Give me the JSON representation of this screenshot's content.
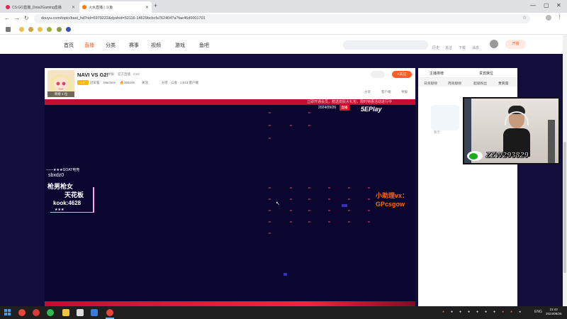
{
  "browser": {
    "tabs": [
      {
        "label": "CS:GO直播_Dota2Gaming直播"
      },
      {
        "label": "火水直播 | 斗鱼"
      }
    ],
    "new_tab": "+",
    "url": "douyu.com/topic/bast_hd?rid=6979222&dyshid=52116-14629bcbcfa762404?a?fae46d0001701",
    "controls": {
      "minimize": "—",
      "maximize": "▢",
      "close": "✕"
    }
  },
  "site_nav": {
    "items": [
      "首页",
      "直播",
      "分类",
      "赛事",
      "视频",
      "游戏",
      "鱼吧"
    ],
    "active_index": 1,
    "header_icons": [
      "历史",
      "关注",
      "下载",
      "消息"
    ],
    "live_button": "开播"
  },
  "room": {
    "title": "NAVI VS G2!",
    "title_suffix": "举报",
    "category": "官方直播 · CS2",
    "level": "LV",
    "anchor_name": "冠军猫",
    "tag": "Machine",
    "heat": "359246",
    "fans": "关注",
    "rank_badge": "周榜 1 位",
    "meta_more": "分享 · 公会 · 1,513 客户端",
    "follow": "+关注",
    "actions": [
      "分享",
      "客户端",
      "举报"
    ]
  },
  "video": {
    "ticker": "立即开通会员，赠送皮肤大礼包，限时特惠活动进行中",
    "date": "2024/09/26",
    "date_badge": "直播",
    "logo": "5EPlay",
    "overlay_left": {
      "line1": "——★★★GOAT电竞",
      "line2": "sbxdz0",
      "line3": "枪男枪女",
      "line4": "天花板",
      "line5": "kook:4628",
      "line6": "★★★"
    },
    "assistant_line1": "小助理vx：",
    "assistant_line2": "GPcsgow"
  },
  "right_panel": {
    "top_tabs": [
      "主播排榜",
      "贵宾席位"
    ],
    "tabs": [
      "日贡献榜",
      "周贡献榜",
      "超级粉丝",
      "贵宾席"
    ],
    "empty_hint": "暂无"
  },
  "webcam": {
    "wechat_id": "ZZW293829"
  },
  "taskbar": {
    "tray_lang": "ENG",
    "time": "21:42",
    "date": "2024/09/26"
  }
}
